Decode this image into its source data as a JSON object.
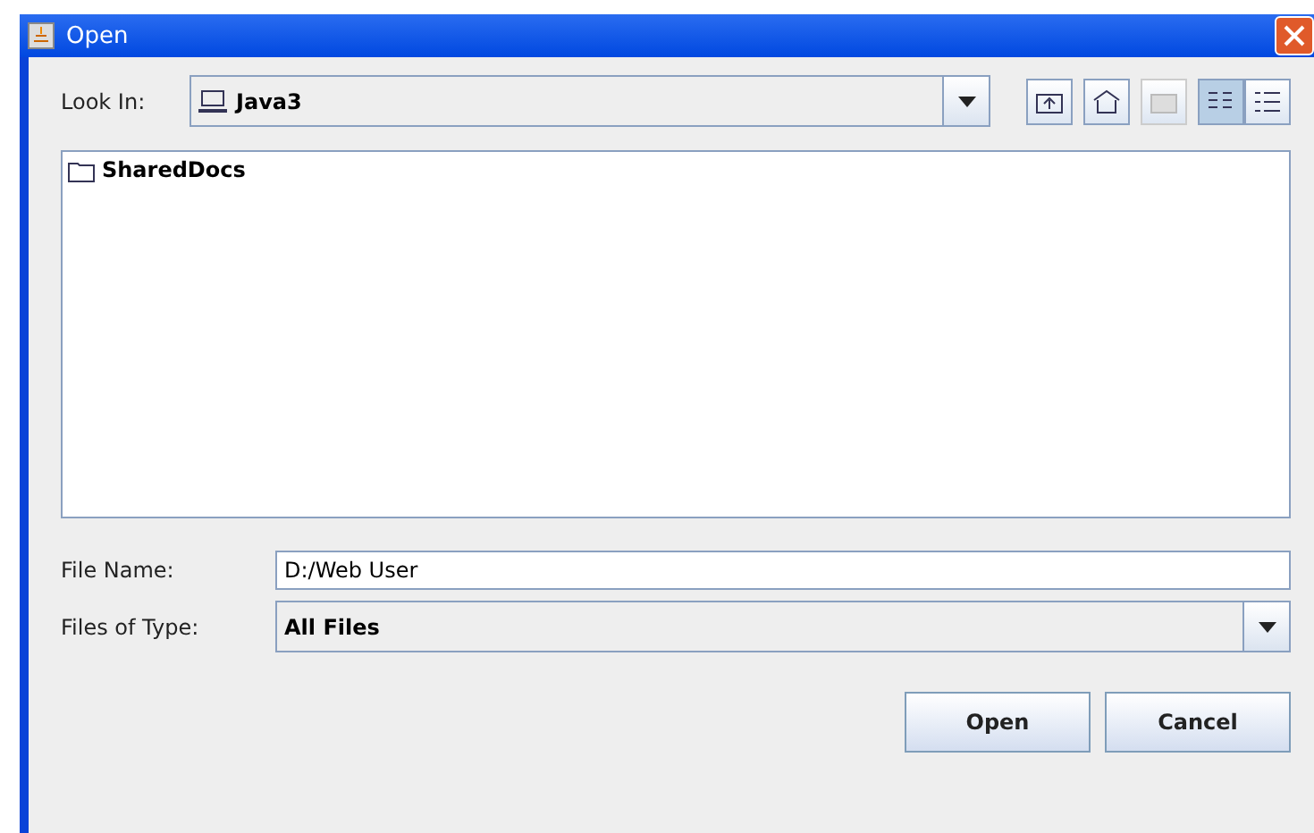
{
  "window": {
    "title": "Open"
  },
  "look_in": {
    "label": "Look In:",
    "value": "Java3"
  },
  "toolbar": [
    {
      "kind": "up",
      "disabled": false,
      "selected": false
    },
    {
      "kind": "home",
      "disabled": false,
      "selected": false
    },
    {
      "kind": "newfolder",
      "disabled": true,
      "selected": false
    },
    {
      "kind": "list",
      "disabled": false,
      "selected": true
    },
    {
      "kind": "details",
      "disabled": false,
      "selected": false
    }
  ],
  "files": [
    {
      "name": "SharedDocs"
    }
  ],
  "file_name": {
    "label": "File Name:",
    "value": "D:/Web User"
  },
  "files_of_type": {
    "label": "Files of Type:",
    "value": "All Files"
  },
  "buttons": [
    "Open",
    "Cancel"
  ]
}
